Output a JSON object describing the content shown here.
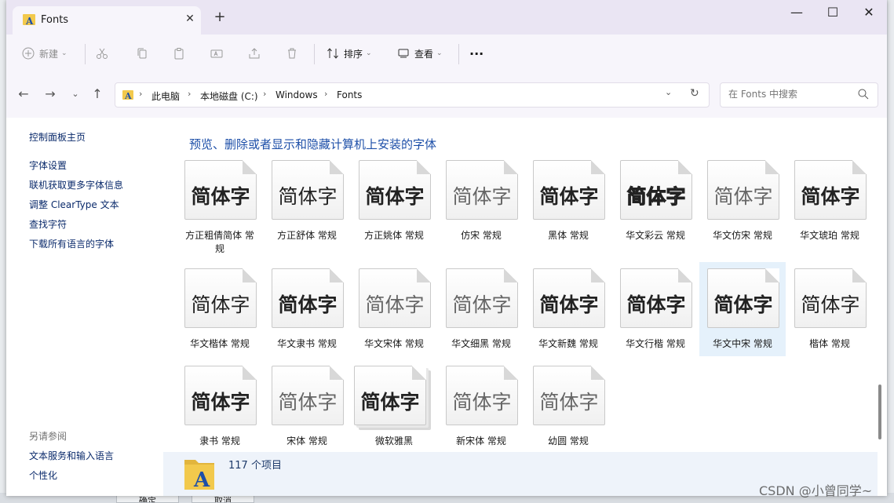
{
  "window": {
    "title": "Fonts",
    "new_tab": "+",
    "minimize": "—",
    "maximize": "☐",
    "close": "✕",
    "tab_close": "✕"
  },
  "toolbar": {
    "new_label": "新建",
    "sort_label": "排序",
    "view_label": "查看",
    "more_label": "···"
  },
  "address": {
    "crumbs": [
      "此电脑",
      "本地磁盘 (C:)",
      "Windows",
      "Fonts"
    ],
    "separator": "›"
  },
  "search": {
    "placeholder": "在 Fonts 中搜索"
  },
  "sidebar": {
    "home": "控制面板主页",
    "links": [
      "字体设置",
      "联机获取更多字体信息",
      "调整 ClearType 文本",
      "查找字符",
      "下载所有语言的字体"
    ],
    "see_also_title": "另请参阅",
    "see_also": [
      "文本服务和输入语言",
      "个性化"
    ]
  },
  "content": {
    "heading": "预览、删除或者显示和隐藏计算机上安装的字体"
  },
  "sample_text": "简体字",
  "fonts": [
    {
      "name": "方正粗倩简体 常规"
    },
    {
      "name": "方正舒体 常规"
    },
    {
      "name": "方正姚体 常规"
    },
    {
      "name": "仿宋 常规"
    },
    {
      "name": "黑体 常规"
    },
    {
      "name": "华文彩云 常规"
    },
    {
      "name": "华文仿宋 常规"
    },
    {
      "name": "华文琥珀 常规"
    },
    {
      "name": "华文楷体 常规"
    },
    {
      "name": "华文隶书 常规"
    },
    {
      "name": "华文宋体 常规"
    },
    {
      "name": "华文细黑 常规"
    },
    {
      "name": "华文新魏 常规"
    },
    {
      "name": "华文行楷 常规"
    },
    {
      "name": "华文中宋 常规"
    },
    {
      "name": "楷体 常规"
    },
    {
      "name": "隶书 常规"
    },
    {
      "name": "宋体 常规"
    },
    {
      "name": "微软雅黑"
    },
    {
      "name": "新宋体 常规"
    },
    {
      "name": "幼圆 常规"
    }
  ],
  "status": {
    "item_count": "117 个项目"
  },
  "background": {
    "ok_button": "确定",
    "cancel_button": "取消"
  },
  "watermark": "CSDN @小曾同学~",
  "colors": {
    "accent": "#1d4fa8",
    "link": "#0a2a6b",
    "selection": "#e5f1fb",
    "title_bar": "#eae5f3"
  }
}
